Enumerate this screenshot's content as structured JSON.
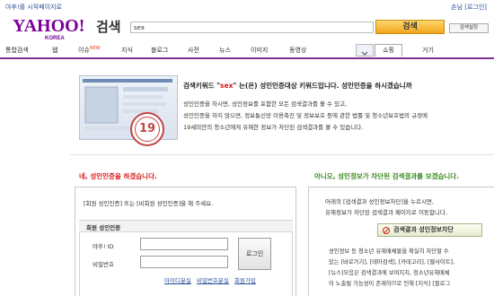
{
  "header": {
    "top_left_link": "야후!를 시작페이지로",
    "top_right_links": "손님 [로그인]",
    "logo_text": "YAHOO!",
    "logo_sub": "KOREA",
    "search_label": "검색",
    "search_value": "sex",
    "search_button": "검색",
    "search_settings": "검색설정"
  },
  "nav": {
    "tabs": [
      "통합검색",
      "웹",
      "이슈",
      "지식",
      "블로그",
      "사전",
      "뉴스",
      "이미지",
      "동영상",
      "쇼핑",
      "거기"
    ],
    "issue_badge": "NEW",
    "active_tab": "쇼핑"
  },
  "warning": {
    "title_prefix": "검색키워드 \"",
    "keyword": "sex",
    "title_suffix": "\" 는(은) 성인인증대상 키워드입니다. 성인인증을 하시겠습니까",
    "line1": "성인인증을 하시면, 성인정보를 포함한 모든 검색결과를 볼 수 있고,",
    "line2": "성인인증을 하지 않으면, 정보통신망 이용촉진 및 정보보호 등에 관한 법률 및 청소년보호법의 규정에",
    "line3": "19세미만의 청소년에게 유해한 정보가 차단된 검색결과를 볼 수 있습니다.",
    "badge_number": "19"
  },
  "left": {
    "heading": "네, 성인인증을 하겠습니다.",
    "instruction": "[회원 성인인증] 또는 [비회원 성인인증]을 해 주세요.",
    "box_title": "회원 성인인증",
    "id_label": "야후! ID",
    "pw_label": "비밀번호",
    "login_button": "로그인",
    "links": [
      "아이디분실",
      "비밀번호분실",
      "회원가입"
    ]
  },
  "right": {
    "heading": "아니오, 성인정보가 차단된 검색결과를 보겠습니다.",
    "desc1": "아래의 [검색결과 성인정보차단]을 누르시면,",
    "desc2": "유해정보가 차단된 검색결과 페이지로 이동합니다.",
    "block_button": "검색결과 성인정보차단",
    "note1": "성인정보 등 청소년 유해매체물을 확실히 차단할 수",
    "note2": "있는 [바로가기], [테마검색], [카테고리], [웹사이트],",
    "note3": "[뉴스]모음은 검색결과에 보여지지, 청소년유해매체",
    "note4": "이 노출될 가능성이 존재하므로 인해 [지식] [블로그"
  }
}
